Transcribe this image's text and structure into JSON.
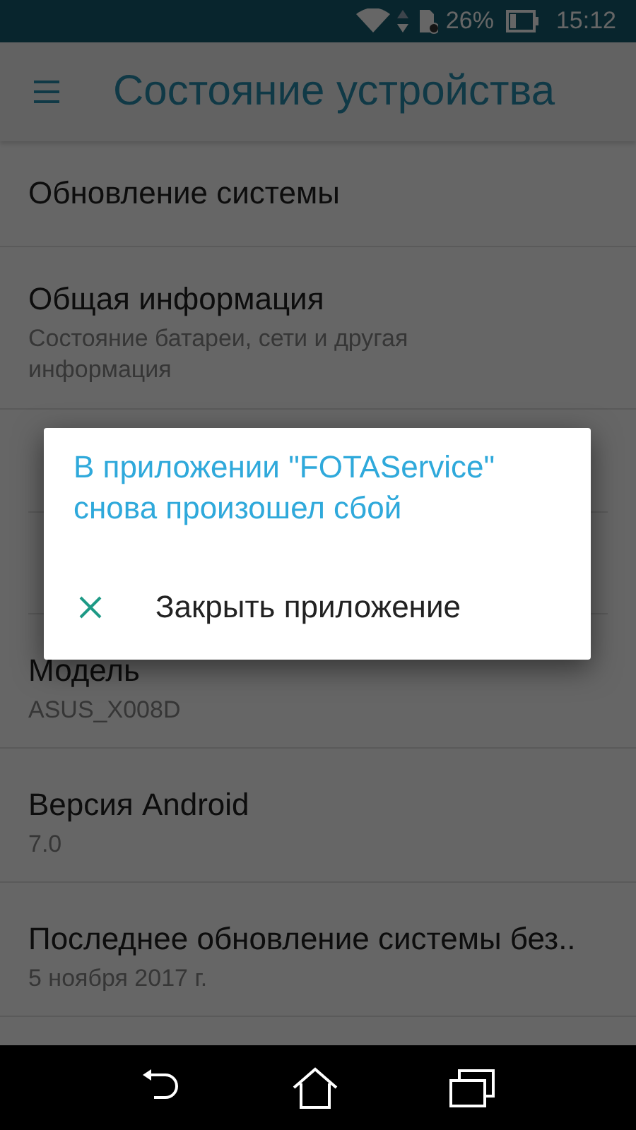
{
  "status_bar": {
    "battery": "26%",
    "time": "15:12"
  },
  "app_bar": {
    "title": "Состояние устройства"
  },
  "items": [
    {
      "title": "Обновление системы"
    },
    {
      "title": "Общая информация",
      "subtitle": "Состояние батареи, сети и другая информация"
    },
    {
      "title": "Модель",
      "subtitle": "ASUS_X008D"
    },
    {
      "title": "Версия Android",
      "subtitle": "7.0"
    },
    {
      "title": "Последнее обновление системы без..",
      "subtitle": "5 ноября 2017 г."
    }
  ],
  "dialog": {
    "title": "В приложении \"FOTAService\" снова произошел сбой",
    "actions": [
      {
        "label": "Закрыть приложение"
      }
    ]
  }
}
